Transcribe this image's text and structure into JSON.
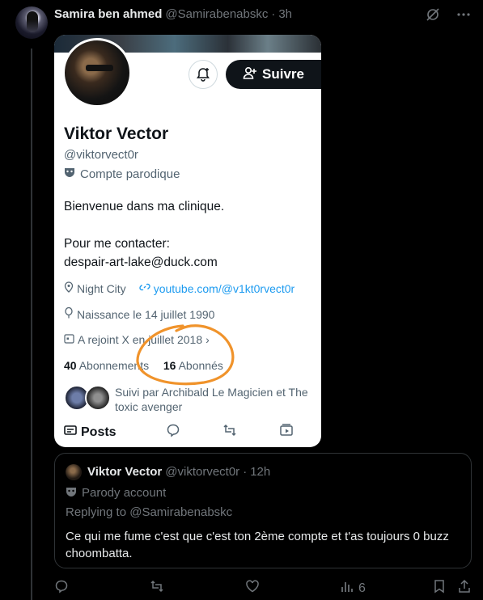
{
  "post": {
    "author_name": "Samira ben ahmed",
    "author_handle": "@Samirabenabskc",
    "separator": "·",
    "time": "3h"
  },
  "card": {
    "follow_label": "Suivre",
    "name": "Viktor Vector",
    "handle": "@viktorvect0r",
    "parody_label": "Compte parodique",
    "bio_line1": "Bienvenue dans ma clinique.",
    "bio_line2": "Pour me contacter:",
    "bio_line3": "despair-art-lake@duck.com",
    "location": "Night City",
    "website": "youtube.com/@v1kt0rvect0r",
    "birthday": "Naissance le 14 juillet 1990",
    "joined": "A rejoint X en juillet 2018",
    "following_count": "40",
    "following_label": "Abonnements",
    "followers_count": "16",
    "followers_label": "Abonnés",
    "followed_by": "Suivi par Archibald Le Magicien et The toxic avenger",
    "tab_posts": "Posts",
    "highlight_color": "#f0932b"
  },
  "quote": {
    "author_name": "Viktor Vector",
    "author_handle": "@viktorvect0r",
    "separator": "·",
    "time": "12h",
    "parody_label": "Parody account",
    "replying_to": "Replying to @Samirabenabskc",
    "text": "Ce qui me fume c'est que c'est ton 2ème compte et t'as toujours 0 buzz choombatta."
  },
  "actions": {
    "views_count": "6"
  },
  "colors": {
    "background": "#000000",
    "muted": "#71767b",
    "link": "#1d9bf0",
    "border": "#2f3336"
  }
}
